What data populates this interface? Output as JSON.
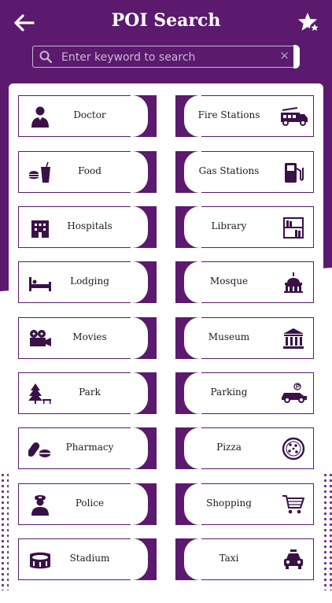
{
  "header": {
    "title": "POI Search"
  },
  "search": {
    "placeholder": "Enter keyword to search"
  },
  "categories": [
    {
      "label": "Doctor",
      "icon": "doctor-icon"
    },
    {
      "label": "Fire Stations",
      "icon": "fire-truck-icon"
    },
    {
      "label": "Food",
      "icon": "food-icon"
    },
    {
      "label": "Gas Stations",
      "icon": "gas-pump-icon"
    },
    {
      "label": "Hospitals",
      "icon": "hospital-building-icon"
    },
    {
      "label": "Library",
      "icon": "bookshelf-icon"
    },
    {
      "label": "Lodging",
      "icon": "bed-icon"
    },
    {
      "label": "Mosque",
      "icon": "dome-building-icon"
    },
    {
      "label": "Movies",
      "icon": "film-camera-icon"
    },
    {
      "label": "Museum",
      "icon": "museum-icon"
    },
    {
      "label": "Park",
      "icon": "tree-bench-icon"
    },
    {
      "label": "Parking",
      "icon": "parking-car-icon"
    },
    {
      "label": "Pharmacy",
      "icon": "pills-icon"
    },
    {
      "label": "Pizza",
      "icon": "pizza-icon"
    },
    {
      "label": "Police",
      "icon": "police-officer-icon"
    },
    {
      "label": "Shopping",
      "icon": "shopping-cart-icon"
    },
    {
      "label": "Stadium",
      "icon": "stadium-icon"
    },
    {
      "label": "Taxi",
      "icon": "taxi-icon"
    }
  ],
  "colors": {
    "primary": "#5b1a6e",
    "tile_border": "#5b1a6e",
    "text": "#1c1c1c"
  }
}
